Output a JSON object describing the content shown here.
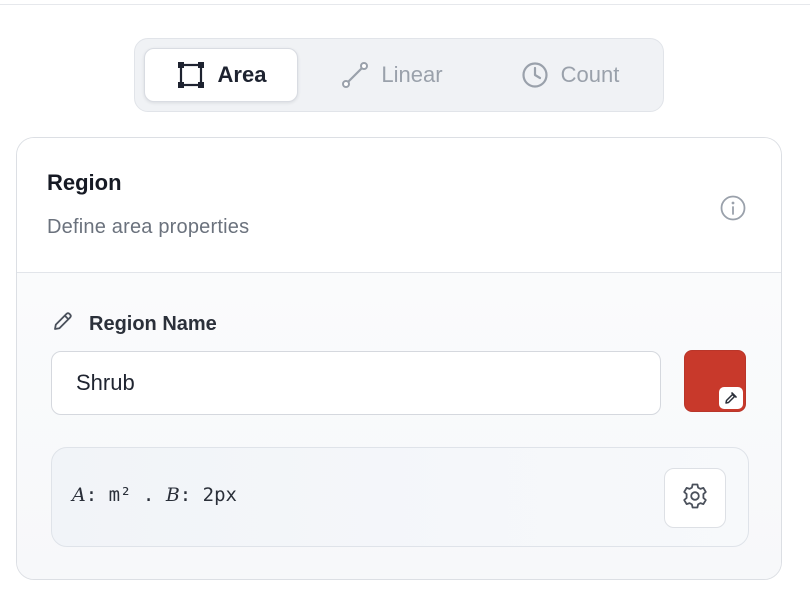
{
  "tabs": [
    {
      "label": "Area",
      "icon": "bounding-box-icon",
      "active": true
    },
    {
      "label": "Linear",
      "icon": "line-icon",
      "active": false
    },
    {
      "label": "Count",
      "icon": "clock-icon",
      "active": false
    }
  ],
  "card": {
    "title": "Region",
    "subtitle": "Define area properties",
    "info_icon": "info-icon"
  },
  "region_name": {
    "label": "Region Name",
    "label_icon": "pencil-icon",
    "value": "Shrub",
    "color": "#c8392b"
  },
  "formula": {
    "var_a": "A",
    "unit_a": ": m² . ",
    "var_b": "B",
    "unit_b": ": 2px",
    "settings_icon": "gear-icon"
  },
  "colors": {
    "accent": "#c8392b",
    "active_text": "#1e2330",
    "inactive_text": "#9aa1ab"
  }
}
